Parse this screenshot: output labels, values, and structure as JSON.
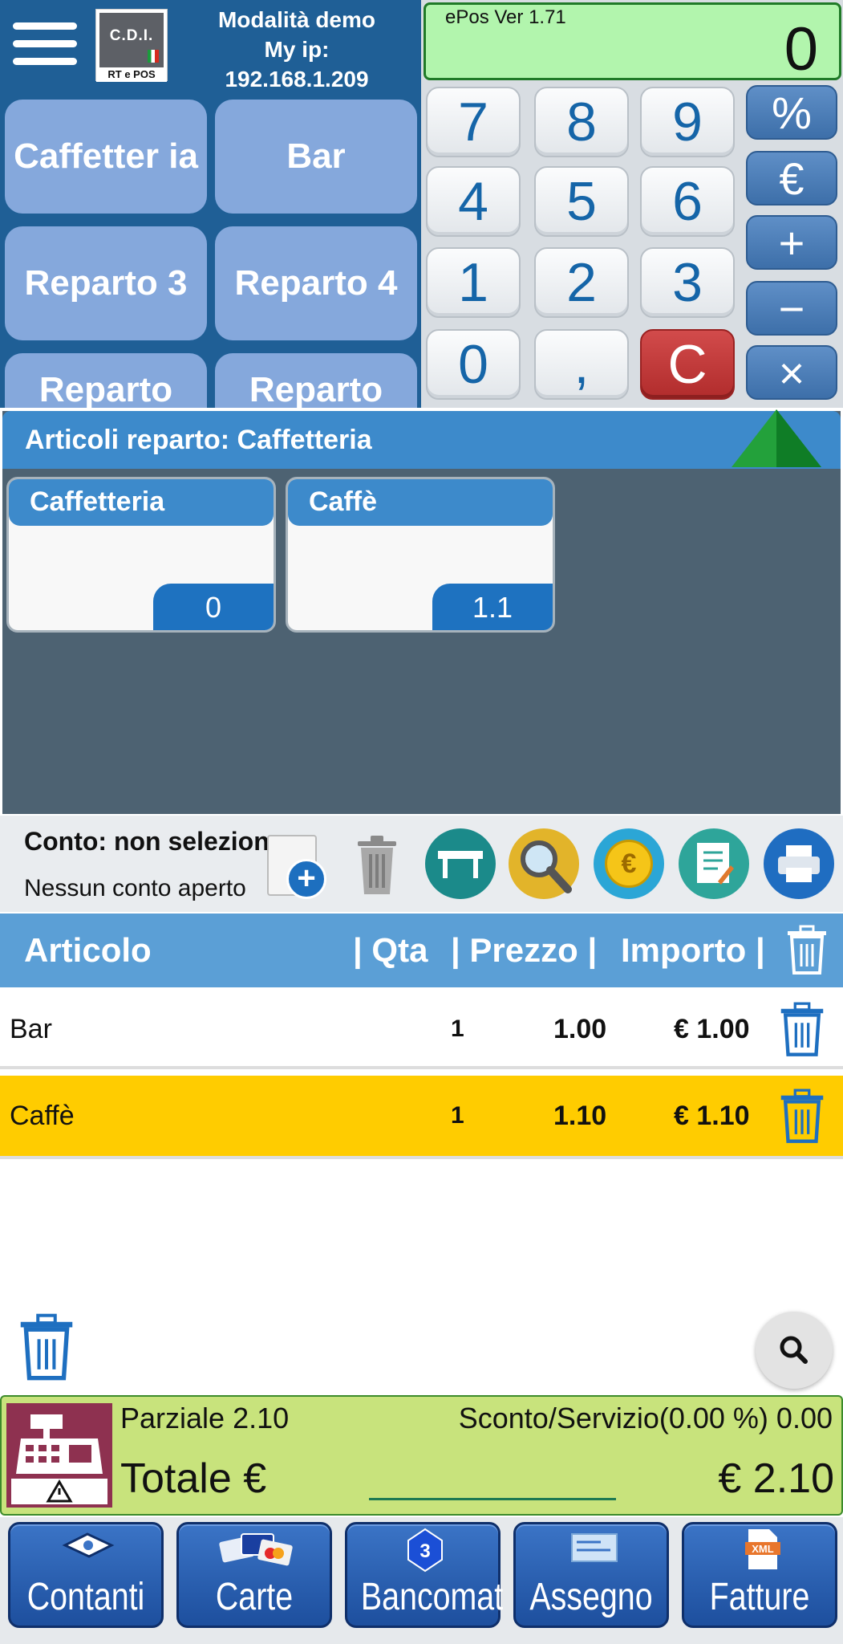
{
  "header": {
    "logo_top": "C.D.I.",
    "logo_bottom": "RT e POS",
    "demo_line1": "Modalità demo",
    "demo_line2": "My ip:",
    "demo_line3": "192.168.1.209"
  },
  "departments": [
    {
      "label": "Caffetter ia"
    },
    {
      "label": "Bar"
    },
    {
      "label": "Reparto 3"
    },
    {
      "label": "Reparto 4"
    },
    {
      "label": "Reparto"
    },
    {
      "label": "Reparto"
    }
  ],
  "calculator": {
    "version": "ePos Ver 1.71",
    "display": "0",
    "keys": [
      "7",
      "8",
      "9",
      "4",
      "5",
      "6",
      "1",
      "2",
      "3",
      "0",
      ",",
      "C"
    ],
    "ops": [
      "%",
      "€",
      "+",
      "−",
      "×"
    ]
  },
  "articles": {
    "header": "Articoli reparto: Caffetteria",
    "items": [
      {
        "name": "Caffetteria",
        "price": "0"
      },
      {
        "name": "Caffè",
        "price": "1.1"
      }
    ]
  },
  "account": {
    "title": "Conto: non selezionato",
    "subtitle": "Nessun conto aperto"
  },
  "table": {
    "headers": {
      "articolo": "Articolo",
      "qta": "| Qta",
      "prezzo": "| Prezzo |",
      "importo": "Importo |"
    },
    "rows": [
      {
        "articolo": "Bar",
        "qta": "1",
        "prezzo": "1.00",
        "importo": "€ 1.00",
        "highlight": false
      },
      {
        "articolo": "Caffè",
        "qta": "1",
        "prezzo": "1.10",
        "importo": "€ 1.10",
        "highlight": true
      }
    ]
  },
  "totals": {
    "parziale": "Parziale 2.10",
    "sconto": "Sconto/Servizio(0.00 %) 0.00",
    "totale_label": "Totale €",
    "totale_value": "€ 2.10"
  },
  "payments": [
    "Contanti",
    "Carte",
    "Bancomat",
    "Assegno",
    "Fatture"
  ],
  "colors": {
    "header_blue": "#1f5f96",
    "dept_button": "#85a8dc",
    "highlight_row": "#ffcc00",
    "totals_bg": "#c8e37c",
    "display_bg": "#b2f5ad"
  }
}
